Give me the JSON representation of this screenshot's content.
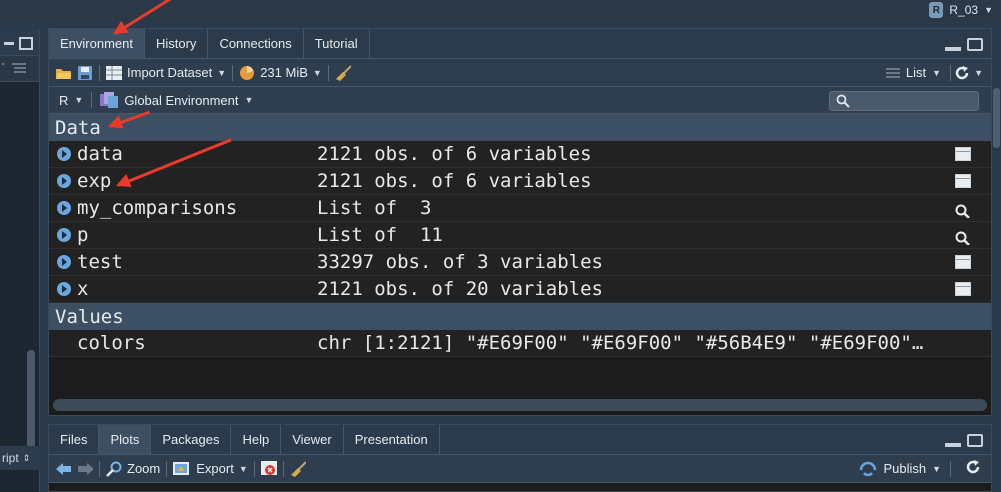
{
  "project": {
    "name": "R_03"
  },
  "left_pane": {
    "bottom_label": "ript"
  },
  "env_pane": {
    "tabs": [
      "Environment",
      "History",
      "Connections",
      "Tutorial"
    ],
    "active_tab": "Environment",
    "toolbar": {
      "import_label": "Import Dataset",
      "memory_label": "231 MiB",
      "view_mode": "List"
    },
    "scope": {
      "language": "R",
      "environment": "Global Environment"
    },
    "sections": {
      "data": "Data",
      "values": "Values"
    },
    "data_rows": [
      {
        "name": "data",
        "value": "2121 obs. of 6 variables",
        "action": "table-icon"
      },
      {
        "name": "exp",
        "value": "2121 obs. of 6 variables",
        "action": "table-icon"
      },
      {
        "name": "my_comparisons",
        "value": "List of  3",
        "action": "search-icon"
      },
      {
        "name": "p",
        "value": "List of  11",
        "action": "search-icon"
      },
      {
        "name": "test",
        "value": "33297 obs. of 3 variables",
        "action": "table-icon"
      },
      {
        "name": "x",
        "value": "2121 obs. of 20 variables",
        "action": "table-icon"
      }
    ],
    "value_rows": [
      {
        "name": "colors",
        "value": "chr [1:2121] \"#E69F00\" \"#E69F00\" \"#56B4E9\" \"#E69F00\"…"
      }
    ]
  },
  "files_pane": {
    "tabs": [
      "Files",
      "Plots",
      "Packages",
      "Help",
      "Viewer",
      "Presentation"
    ],
    "active_tab": "Plots",
    "toolbar": {
      "zoom_label": "Zoom",
      "export_label": "Export",
      "publish_label": "Publish"
    }
  },
  "colors": {
    "accent_blue": "#6aa6e0",
    "annotation_red": "#ea3a2a",
    "pane_bg": "#2f3e4e"
  }
}
